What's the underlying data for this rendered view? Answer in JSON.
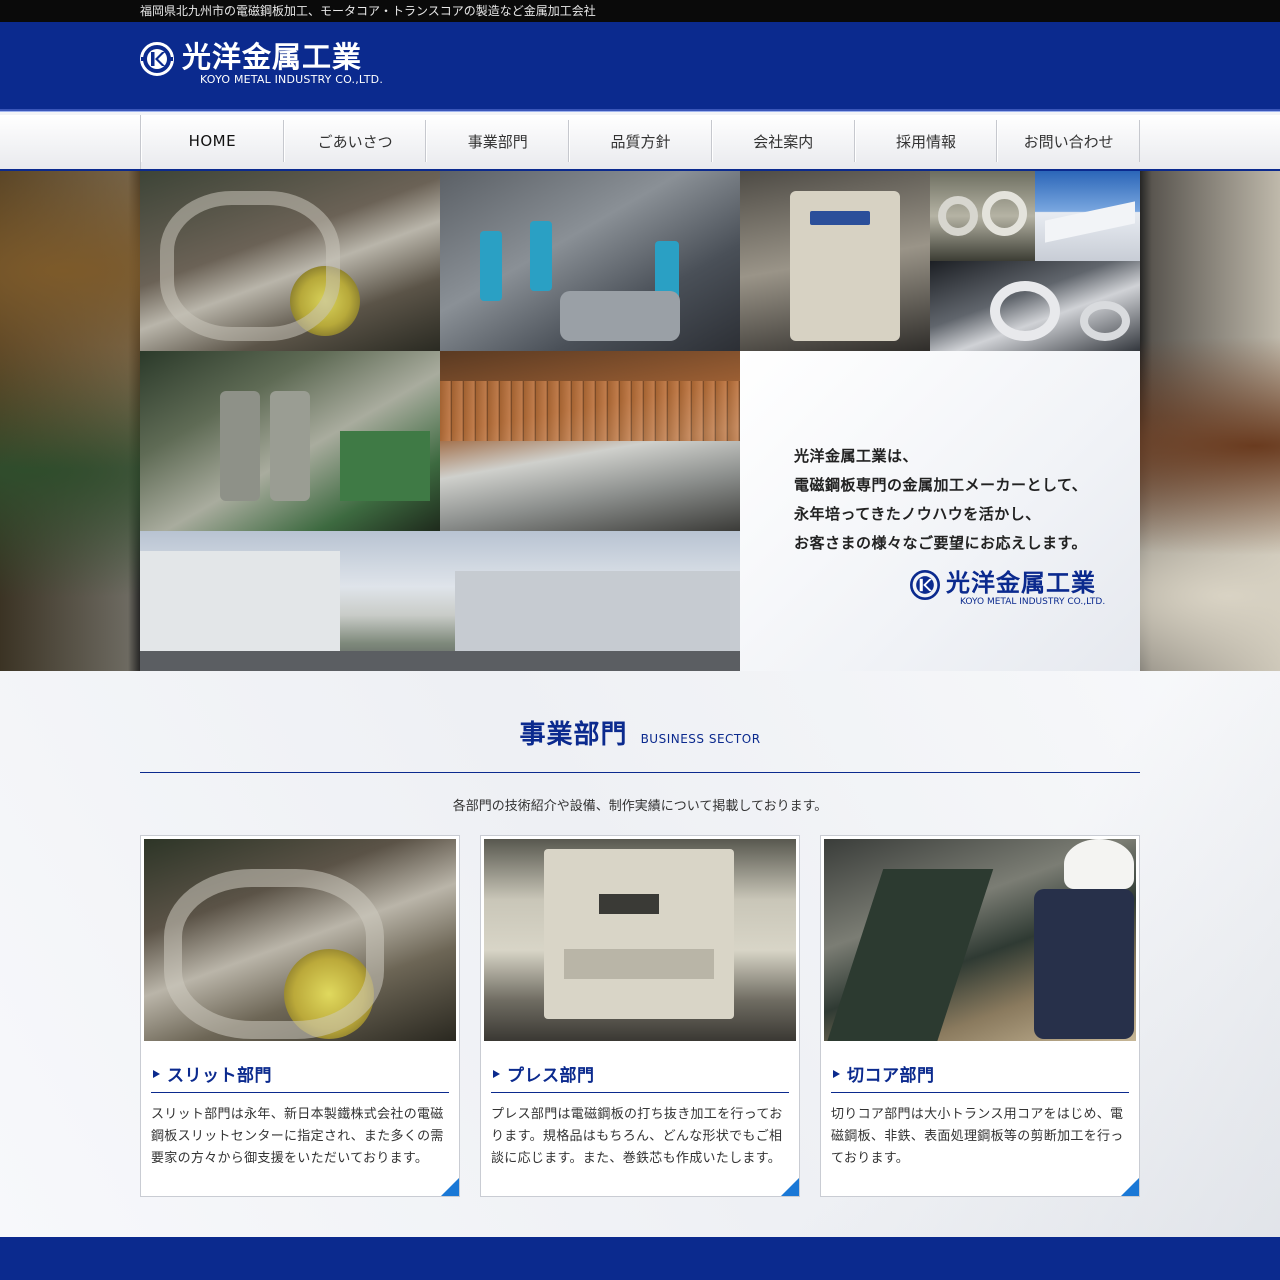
{
  "topbar": {
    "tagline": "福岡県北九州市の電磁鋼板加工、モータコア・トランスコアの製造など金属加工会社"
  },
  "header": {
    "logo_icon": "koyo-k-emblem",
    "logo_jp": "光洋金属工業",
    "logo_en": "KOYO METAL INDUSTRY CO.,LTD."
  },
  "nav": {
    "items": [
      {
        "label": "HOME"
      },
      {
        "label": "ごあいさつ"
      },
      {
        "label": "事業部門"
      },
      {
        "label": "品質方針"
      },
      {
        "label": "会社案内"
      },
      {
        "label": "採用情報"
      },
      {
        "label": "お問い合わせ"
      }
    ],
    "active": "HOME"
  },
  "hero": {
    "lines": [
      "光洋金属工業は、",
      "電磁鋼板専門の金属加工メーカーとして、",
      "永年培ってきたノウハウを活かし、",
      "お客さまの様々なご要望にお応えします。"
    ],
    "logo_jp": "光洋金属工業",
    "logo_en": "KOYO METAL INDUSTRY CO.,LTD."
  },
  "business": {
    "title_jp": "事業部門",
    "title_en": "BUSINESS SECTOR",
    "description": "各部門の技術紹介や設備、制作実績について掲載しております。",
    "cards": [
      {
        "title": "スリット部門",
        "text": "スリット部門は永年、新日本製鐵株式会社の電磁鋼板スリットセンターに指定され、また多くの需要家の方々から御支援をいただいております。"
      },
      {
        "title": "プレス部門",
        "text": "プレス部門は電磁鋼板の打ち抜き加工を行っております。規格品はもちろん、どんな形状でもご相談に応じます。また、巻鉄芯も作成いたします。"
      },
      {
        "title": "切コア部門",
        "text": "切りコア部門は大小トランス用コアをはじめ、電磁鋼板、非鉄、表面処理鋼板等の剪断加工を行っております。"
      }
    ]
  },
  "colors": {
    "brand": "#0b2a8e",
    "accent": "#1a78d6"
  }
}
